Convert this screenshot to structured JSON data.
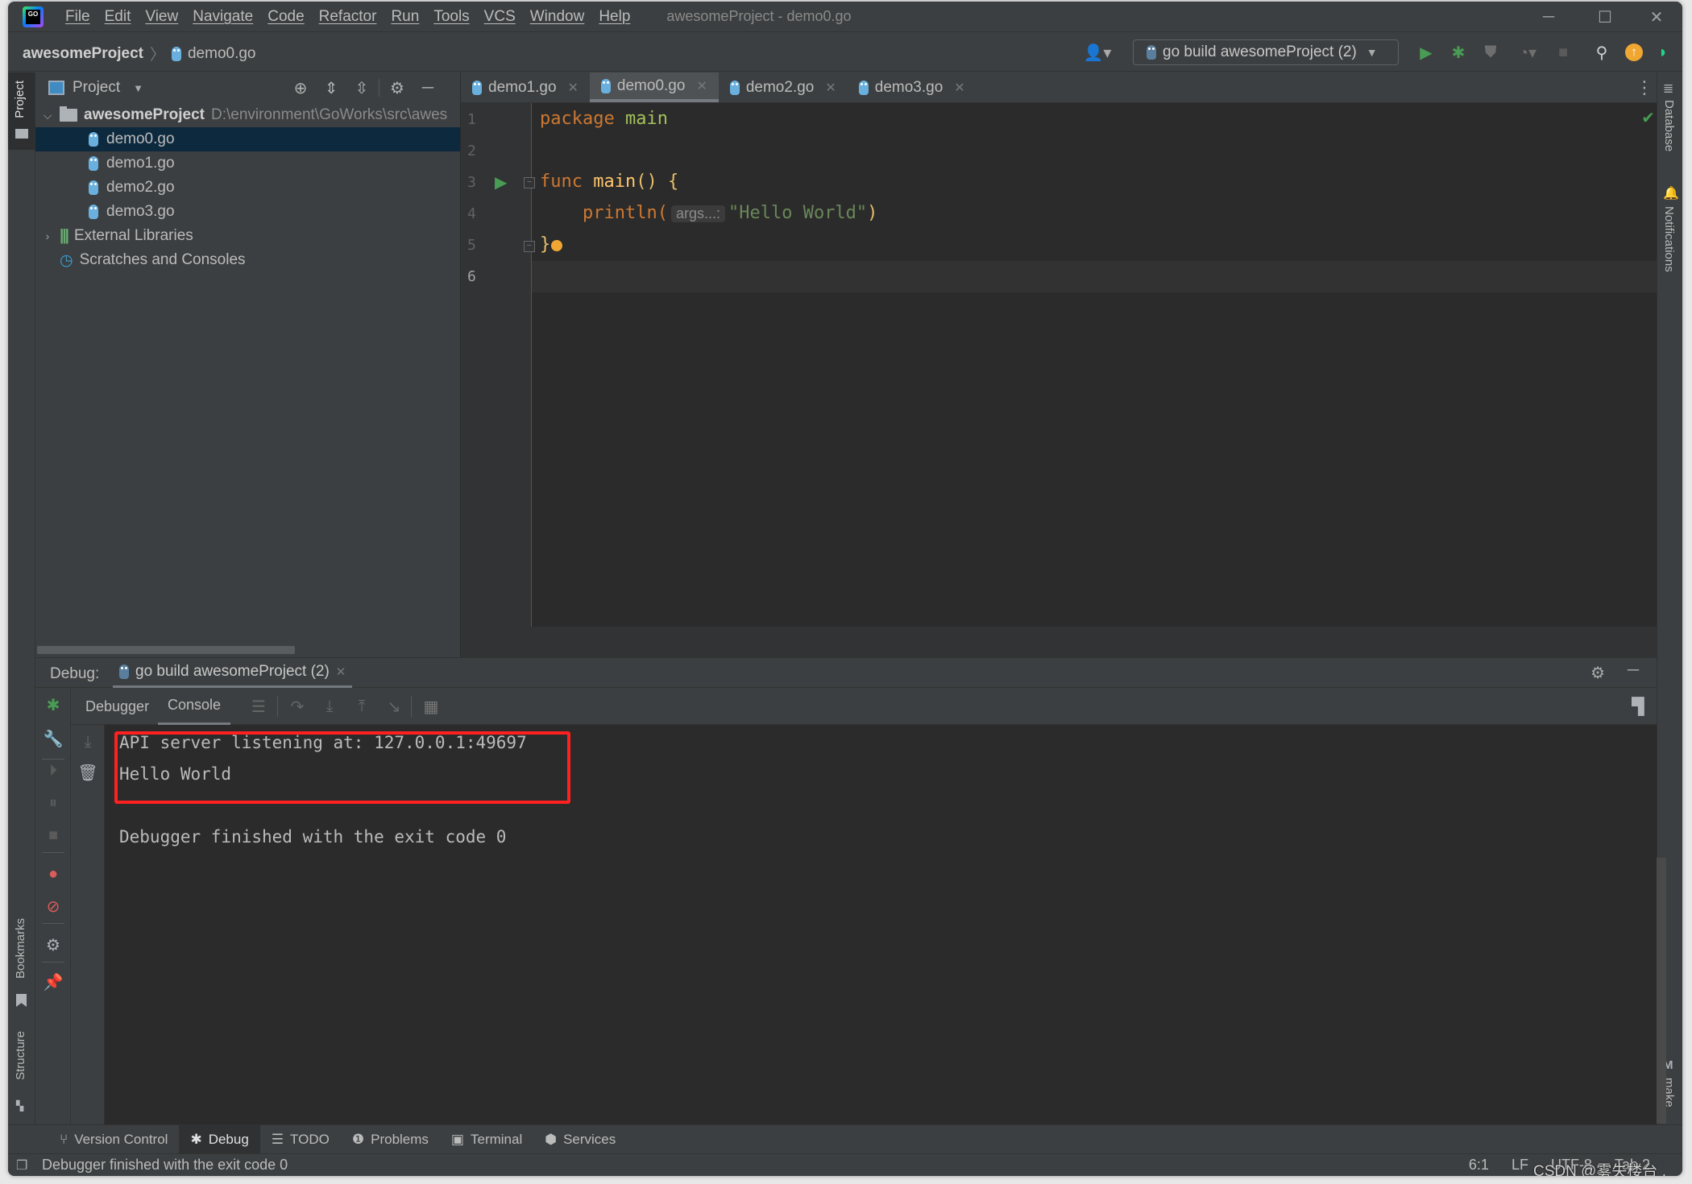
{
  "window": {
    "title": "awesomeProject - demo0.go",
    "menu": [
      "File",
      "Edit",
      "View",
      "Navigate",
      "Code",
      "Refactor",
      "Run",
      "Tools",
      "VCS",
      "Window",
      "Help"
    ],
    "controls": {
      "minimize": "─",
      "maximize": "☐",
      "close": "✕"
    }
  },
  "navbar": {
    "breadcrumb": {
      "project": "awesomeProject",
      "separator": "〉",
      "file": "demo0.go"
    },
    "run_config": "go build awesomeProject (2)",
    "icons": [
      "user-icon",
      "run-icon",
      "debug-icon",
      "coverage-icon",
      "profile-icon",
      "stop-icon",
      "search-icon",
      "update-icon",
      "toolbox-icon"
    ]
  },
  "left_stripe": {
    "project": "Project",
    "bookmarks": "Bookmarks",
    "structure": "Structure"
  },
  "right_stripe": {
    "database": "Database",
    "notifications": "Notifications",
    "make": "make"
  },
  "project_panel": {
    "title": "Project",
    "root": {
      "name": "awesomeProject",
      "path": "D:\\environment\\GoWorks\\src\\awes"
    },
    "files": [
      {
        "name": "demo0.go",
        "selected": true
      },
      {
        "name": "demo1.go",
        "selected": false
      },
      {
        "name": "demo2.go",
        "selected": false
      },
      {
        "name": "demo3.go",
        "selected": false
      }
    ],
    "external_libraries": "External Libraries",
    "scratches": "Scratches and Consoles"
  },
  "editor": {
    "tabs": [
      {
        "label": "demo1.go",
        "active": false
      },
      {
        "label": "demo0.go",
        "active": true
      },
      {
        "label": "demo2.go",
        "active": false
      },
      {
        "label": "demo3.go",
        "active": false
      }
    ],
    "line_numbers": [
      "1",
      "2",
      "3",
      "4",
      "5",
      "6"
    ],
    "code": {
      "l1_kw": "package",
      "l1_name": "main",
      "l3_kw": "func",
      "l3_fn": "main",
      "l3_rest": "() {",
      "l4_fn": "println(",
      "l4_hint": "args...:",
      "l4_str": "\"Hello World\"",
      "l4_close": ")",
      "l5": "}"
    },
    "cursor_line": 6,
    "status_ok": "✔"
  },
  "debug": {
    "label": "Debug:",
    "session_tab": "go build awesomeProject (2)",
    "subtabs": [
      {
        "label": "Debugger",
        "active": false
      },
      {
        "label": "Console",
        "active": true
      }
    ],
    "console_lines": [
      "API server listening at: 127.0.0.1:49697",
      "Hello World",
      "",
      "Debugger finished with the exit code 0"
    ],
    "highlight_color": "#ff2020"
  },
  "tool_tabs": [
    {
      "label": "Version Control",
      "icon": "⑂",
      "active": false
    },
    {
      "label": "Debug",
      "icon": "✱",
      "active": true
    },
    {
      "label": "TODO",
      "icon": "☰",
      "active": false
    },
    {
      "label": "Problems",
      "icon": "❶",
      "active": false
    },
    {
      "label": "Terminal",
      "icon": "▣",
      "active": false
    },
    {
      "label": "Services",
      "icon": "⬢",
      "active": false
    }
  ],
  "status_bar": {
    "message": "Debugger finished with the exit code 0",
    "position": "6:1",
    "line_sep": "LF",
    "encoding": "UTF-8",
    "indent": "Tab 2",
    "watermark": "CSDN @雾失楼台 ,"
  }
}
